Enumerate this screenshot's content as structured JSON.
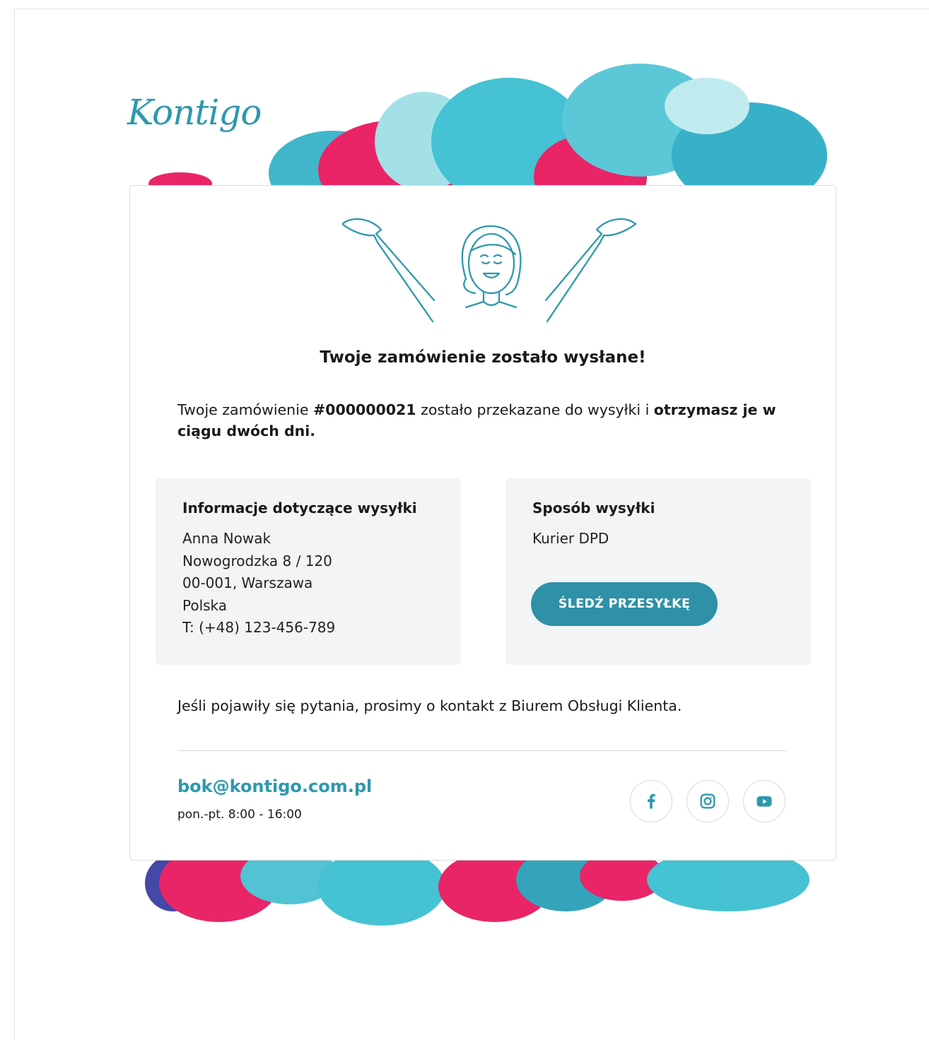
{
  "brand": {
    "logo_text": "Kontigo",
    "accent": "#2e98ad",
    "button_color": "#2e91a8",
    "paint_pink": "#e8195f",
    "paint_teal": "#3cbfd1"
  },
  "heading": "Twoje zamówienie zostało wysłane!",
  "message": {
    "part1": "Twoje zamówienie ",
    "order_number": "#000000021",
    "part2": " zostało przekazane do wysyłki i ",
    "bold_end": "otrzymasz je w ciągu dwóch dni."
  },
  "shipping_info": {
    "title": "Informacje dotyczące wysyłki",
    "name": "Anna Nowak",
    "street": "Nowogrodzka 8 / 120",
    "city": "00-001, Warszawa",
    "country": "Polska",
    "phone": "T: (+48) 123-456-789"
  },
  "shipping_method": {
    "title": "Sposób wysyłki",
    "carrier": "Kurier DPD",
    "track_button": "ŚLEDŹ PRZESYŁKĘ"
  },
  "contact": {
    "line": "Jeśli pojawiły się pytania, prosimy o kontakt z Biurem Obsługi Klienta.",
    "email": "bok@kontigo.com.pl",
    "hours": "pon.-pt. 8:00 - 16:00"
  },
  "social": [
    {
      "icon": "facebook-icon"
    },
    {
      "icon": "instagram-icon"
    },
    {
      "icon": "youtube-icon"
    }
  ]
}
